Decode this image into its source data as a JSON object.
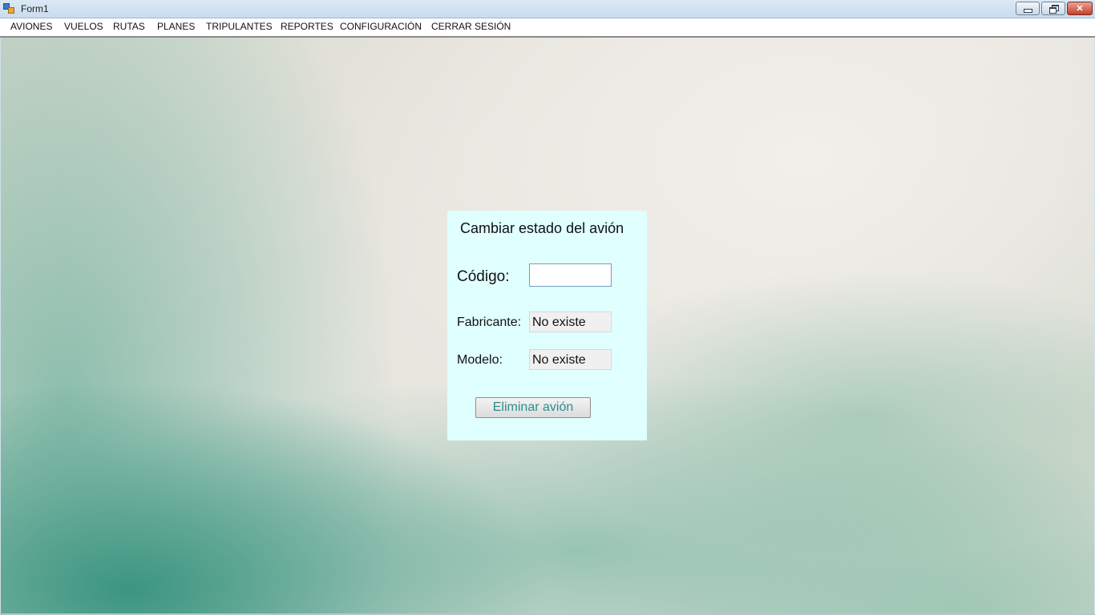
{
  "window": {
    "title": "Form1",
    "controls": {
      "minimize": "minimize-icon",
      "restore": "restore-icon",
      "close": "✕"
    }
  },
  "menu": {
    "items": [
      {
        "label": "AVIONES"
      },
      {
        "label": "VUELOS"
      },
      {
        "label": "RUTAS"
      },
      {
        "label": "PLANES"
      },
      {
        "label": "TRIPULANTES"
      },
      {
        "label": "REPORTES"
      },
      {
        "label": "CONFIGURACIÓN"
      },
      {
        "label": "CERRAR SESIÓN"
      }
    ]
  },
  "panel": {
    "title": "Cambiar estado del avión",
    "codigo_label": "Código:",
    "codigo_value": "",
    "fabricante_label": "Fabricante:",
    "fabricante_value": "No existe",
    "modelo_label": "Modelo:",
    "modelo_value": "No existe",
    "button_label": "Eliminar avión",
    "background_color": "#e0ffff",
    "button_text_color": "#2a8f8a"
  }
}
